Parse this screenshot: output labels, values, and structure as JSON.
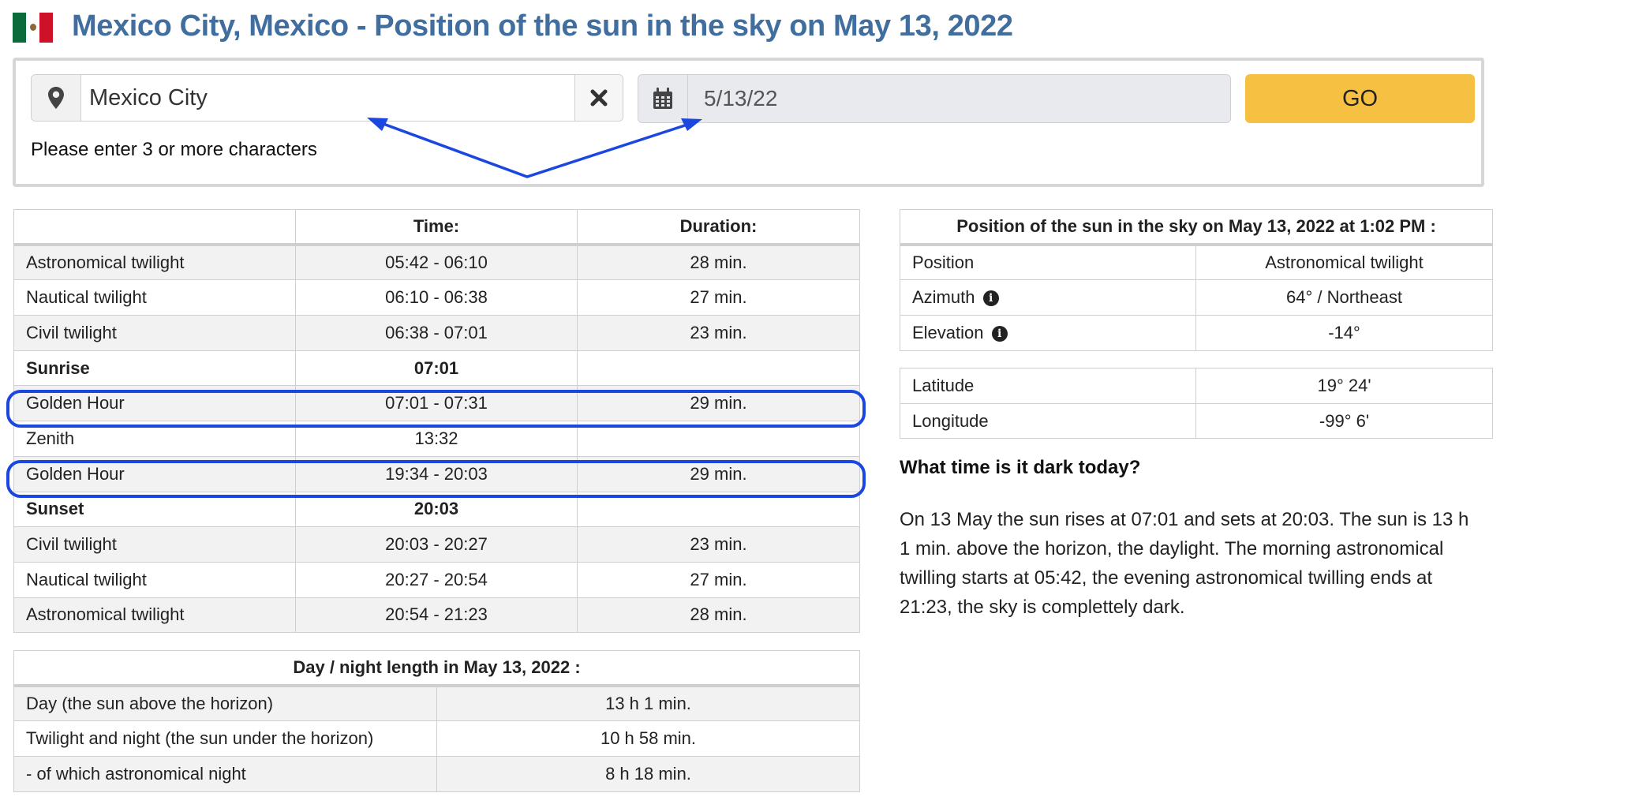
{
  "header": {
    "title": "Mexico City, Mexico - Position of the sun in the sky on May 13, 2022",
    "flag_icon": "mexico-flag-icon"
  },
  "search": {
    "location_value": "Mexico City",
    "location_hint": "Please enter 3 or more characters",
    "date_value": "5/13/22",
    "go_label": "GO",
    "icons": {
      "location": "map-pin-icon",
      "clear": "close-icon",
      "date": "calendar-icon"
    }
  },
  "sun_table": {
    "headers": [
      "",
      "Time:",
      "Duration:"
    ],
    "rows": [
      {
        "label": "Astronomical twilight",
        "time": "05:42 - 06:10",
        "duration": "28 min."
      },
      {
        "label": "Nautical twilight",
        "time": "06:10 - 06:38",
        "duration": "27 min."
      },
      {
        "label": "Civil twilight",
        "time": "06:38 - 07:01",
        "duration": "23 min."
      },
      {
        "label": "Sunrise",
        "time": "07:01",
        "duration": ""
      },
      {
        "label": "Golden Hour",
        "time": "07:01 - 07:31",
        "duration": "29 min."
      },
      {
        "label": "Zenith",
        "time": "13:32",
        "duration": ""
      },
      {
        "label": "Golden Hour",
        "time": "19:34 - 20:03",
        "duration": "29 min."
      },
      {
        "label": "Sunset",
        "time": "20:03",
        "duration": ""
      },
      {
        "label": "Civil twilight",
        "time": "20:03 - 20:27",
        "duration": "23 min."
      },
      {
        "label": "Nautical twilight",
        "time": "20:27 - 20:54",
        "duration": "27 min."
      },
      {
        "label": "Astronomical twilight",
        "time": "20:54 - 21:23",
        "duration": "28 min."
      }
    ]
  },
  "day_table": {
    "header": "Day / night length in May 13, 2022 :",
    "rows": [
      {
        "label": "Day (the sun above the horizon)",
        "value": "13 h 1 min."
      },
      {
        "label": "Twilight and night (the sun under the horizon)",
        "value": "10 h 58 min."
      },
      {
        "label": "- of which astronomical night",
        "value": "8 h 18 min."
      }
    ]
  },
  "position_table": {
    "header": "Position of the sun in the sky on May 13, 2022 at 1:02 PM :",
    "rows": [
      {
        "label": "Position",
        "value": "Astronomical twilight"
      },
      {
        "label": "Azimuth",
        "value": "64° / Northeast"
      },
      {
        "label": "Elevation",
        "value": "-14°"
      }
    ]
  },
  "coords_table": {
    "rows": [
      {
        "label": "Latitude",
        "value": "19° 24'"
      },
      {
        "label": "Longitude",
        "value": "-99° 6'"
      }
    ]
  },
  "dark_section": {
    "question": "What time is it dark today?",
    "text": "On 13 May the sun rises at 07:01 and sets at 20:03. The sun is 13 h 1 min. above the horizon, the daylight. The morning astronomical twilling starts at 05:42, the evening astronomical twilling ends at 21:23, the sky is complettely dark."
  },
  "colors": {
    "title": "#3f6e9f",
    "go_button": "#f6c142",
    "annotation": "#1a47e0",
    "flag_green": "#0b6b3a",
    "flag_white": "#ffffff",
    "flag_red": "#ce1126"
  }
}
